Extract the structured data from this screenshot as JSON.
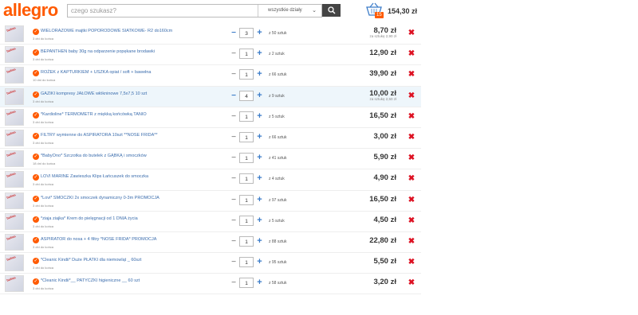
{
  "header": {
    "logo": "allegro",
    "search_placeholder": "czego szukasz?",
    "department": "wszystkie działy",
    "cart_count": "15",
    "cart_total": "154,30 zł"
  },
  "items": [
    {
      "name": "WIELORAZOWE majtki POPORODOWE SIATKOWE- R2 do160cm",
      "delivery": "3 dni do końca",
      "qty": "3",
      "stock": "z 50 sztuk",
      "price": "8,70 zł",
      "unit": "za sztukę 2,90 zł"
    },
    {
      "name": "BEPANTHEN baby 30g na odparzenie popękane brodawki",
      "delivery": "3 dni do końca",
      "qty": "1",
      "stock": "z 2 sztuk",
      "price": "12,90 zł",
      "unit": ""
    },
    {
      "name": "ROŻEK z KAPTURKIEM + USZKA opiat / soft + bawełna",
      "delivery": "10 dni do końca",
      "qty": "1",
      "stock": "z 66 sztuk",
      "price": "39,90 zł",
      "unit": ""
    },
    {
      "name": "GAZIKI kompresy JAŁOWE włókninowe 7,5x7,5 10 szt",
      "delivery": "3 dni do końca",
      "qty": "4",
      "stock": "z 9 sztuk",
      "price": "10,00 zł",
      "unit": "za sztukę 2,50 zł"
    },
    {
      "name": "*Kardioline* TERMOMETR z miękką końcówką TANIO",
      "delivery": "3 dni do końca",
      "qty": "1",
      "stock": "z 5 sztuk",
      "price": "16,50 zł",
      "unit": ""
    },
    {
      "name": "FILTRY wymienne do ASPIRATORA 10szt **NOSE FRIDA**",
      "delivery": "3 dni do końca",
      "qty": "1",
      "stock": "z 66 sztuk",
      "price": "3,00 zł",
      "unit": ""
    },
    {
      "name": "*BabyOno* Szczotka do butelek z GĄBKĄ i smoczków",
      "delivery": "18 dni do końca",
      "qty": "1",
      "stock": "z 41 sztuk",
      "price": "5,90 zł",
      "unit": ""
    },
    {
      "name": "LOVI MARINE Zawieszka Klips Łańcuszek do smoczka",
      "delivery": "3 dni do końca",
      "qty": "1",
      "stock": "z 4 sztuk",
      "price": "4,90 zł",
      "unit": ""
    },
    {
      "name": "*Lovi* SMOCZKI 2x smoczek dynamiczny 0-3m PROMOCJA",
      "delivery": "3 dni do końca",
      "qty": "1",
      "stock": "z 97 sztuk",
      "price": "16,50 zł",
      "unit": ""
    },
    {
      "name": "*ziaja ziajka* Krem do pielęgnacji od 1 DNIA życia",
      "delivery": "3 dni do końca",
      "qty": "1",
      "stock": "z 5 sztuk",
      "price": "4,50 zł",
      "unit": ""
    },
    {
      "name": "ASPIRATOR do nosa + 4 filtry *NOSE FRIDA* PROMOCJA",
      "delivery": "3 dni do końca",
      "qty": "1",
      "stock": "z 88 sztuk",
      "price": "22,80 zł",
      "unit": ""
    },
    {
      "name": "*Cleanic Kindii* Duże PŁATKI dla niemowląt _ 60szt",
      "delivery": "3 dni do końca",
      "qty": "1",
      "stock": "z 95 sztuk",
      "price": "5,50 zł",
      "unit": ""
    },
    {
      "name": "*Cleanic Kindii*__ PATYCZKI higieniczne __ 60 szt",
      "delivery": "3 dni do końca",
      "qty": "1",
      "stock": "z 58 sztuk",
      "price": "3,20 zł",
      "unit": ""
    }
  ],
  "colors": {
    "brand": "#ff5a00",
    "link": "#3b6dad",
    "accent_blue": "#3a7bc8",
    "delete": "#dd1122",
    "highlight": "#eef6fb"
  },
  "icons": {
    "search": "magnifier-icon",
    "cart": "basket-icon",
    "check": "check-circle-icon",
    "delete": "x-icon",
    "minus": "minus-icon",
    "plus": "plus-icon"
  }
}
